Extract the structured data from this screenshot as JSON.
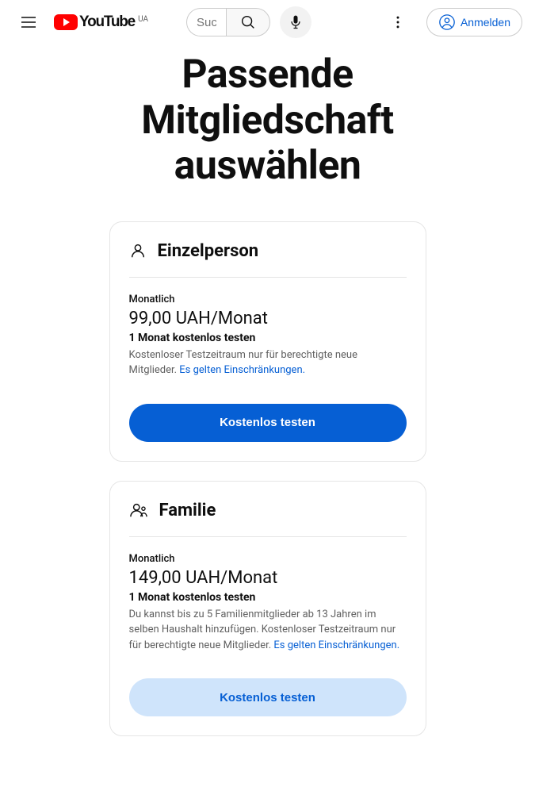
{
  "header": {
    "brand": "YouTube",
    "region": "UA",
    "search_placeholder": "Suchen",
    "signin_label": "Anmelden"
  },
  "page": {
    "title": "Passende Mitgliedschaft auswählen"
  },
  "plans": [
    {
      "name": "Einzelperson",
      "period_label": "Monatlich",
      "price": "99,00 UAH/Monat",
      "trial": "1 Monat kostenlos testen",
      "description": "Kostenloser Testzeitraum nur für berechtigte neue Mitglieder. ",
      "restriction_link": "Es gelten Einschränkungen.",
      "cta": "Kostenlos testen",
      "cta_style": "primary"
    },
    {
      "name": "Familie",
      "period_label": "Monatlich",
      "price": "149,00 UAH/Monat",
      "trial": "1 Monat kostenlos testen",
      "description": "Du kannst bis zu 5 Familienmitglieder ab 13 Jahren im selben Haushalt hinzufügen. Kostenloser Testzeitraum nur für berechtigte neue Mitglieder. ",
      "restriction_link": "Es gelten Einschränkungen.",
      "cta": "Kostenlos testen",
      "cta_style": "secondary"
    }
  ]
}
